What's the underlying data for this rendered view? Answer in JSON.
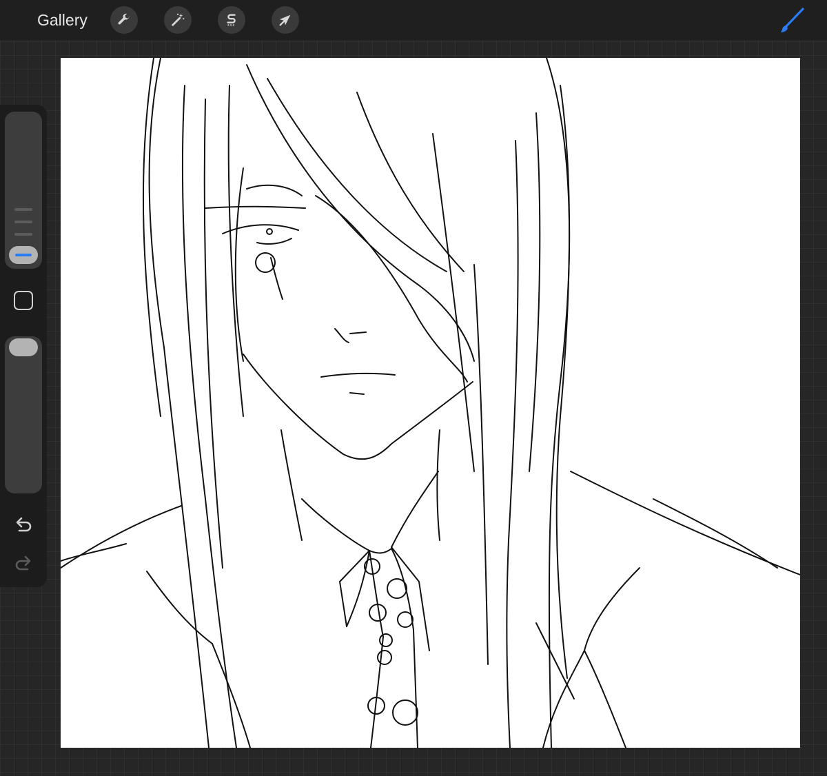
{
  "topbar": {
    "gallery_label": "Gallery",
    "tools": [
      {
        "name": "actions",
        "icon": "wrench-icon"
      },
      {
        "name": "adjustments",
        "icon": "magic-wand-icon"
      },
      {
        "name": "selection",
        "icon": "selection-s-icon"
      },
      {
        "name": "transform",
        "icon": "arrow-cursor-icon"
      }
    ],
    "brush_icon": "brush-icon",
    "accent_color": "#2a7cf6"
  },
  "sidebar": {
    "brush_size_level": 0.12,
    "opacity_level": 1.0,
    "modify_icon": "square-icon",
    "undo_icon": "undo-icon",
    "redo_icon": "redo-icon"
  },
  "canvas": {
    "background": "#ffffff",
    "artwork": "line-sketch"
  }
}
